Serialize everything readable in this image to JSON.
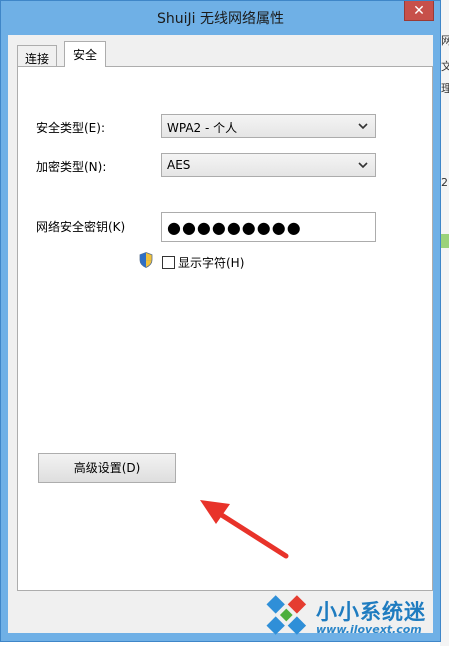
{
  "window": {
    "title": "ShuiJi 无线网络属性",
    "close_glyph": "✕"
  },
  "tabs": [
    {
      "label": "连接",
      "active": false
    },
    {
      "label": "安全",
      "active": true
    }
  ],
  "fields": {
    "security_type": {
      "label": "安全类型(E):",
      "value": "WPA2 - 个人"
    },
    "encryption_type": {
      "label": "加密类型(N):",
      "value": "AES"
    },
    "security_key": {
      "label": "网络安全密钥(K)",
      "value": "●●●●●●●●●"
    }
  },
  "show_chars": {
    "label": "显示字符(H)",
    "checked": false
  },
  "advanced_button": {
    "label": "高级设置(D)"
  },
  "background": {
    "right_chars": [
      "网",
      "文",
      "理",
      "2"
    ]
  },
  "watermark": {
    "name": "小小系统迷",
    "url": "www.ilovext.com"
  },
  "colors": {
    "title_bar": "#6fb0e6",
    "close_button": "#c7504a",
    "arrow": "#e8332a",
    "watermark": "#1f7cc0"
  }
}
